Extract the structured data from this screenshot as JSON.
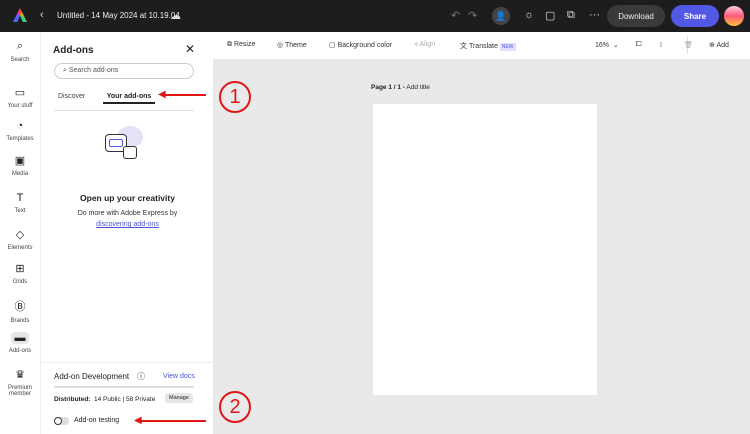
{
  "topbar": {
    "title": "Untitled - 14 May 2024 at 10.19.04",
    "download": "Download",
    "share": "Share"
  },
  "rail": [
    {
      "label": "Search",
      "icon": "⌕"
    },
    {
      "label": "Your stuff",
      "icon": "▭"
    },
    {
      "label": "Templates",
      "icon": "◔"
    },
    {
      "label": "Media",
      "icon": "▣"
    },
    {
      "label": "Text",
      "icon": "T"
    },
    {
      "label": "Elements",
      "icon": "◇"
    },
    {
      "label": "Grids",
      "icon": "⊞"
    },
    {
      "label": "Brands",
      "icon": "Ⓑ"
    },
    {
      "label": "Add-ons",
      "icon": "▬"
    },
    {
      "label": "Premium member",
      "icon": "♛"
    }
  ],
  "panel": {
    "title": "Add-ons",
    "search_placeholder": "Search add-ons",
    "tabs": [
      "Discover",
      "Your add-ons"
    ],
    "empty_title": "Open up your creativity",
    "empty_text": "Do more with Adobe Express by",
    "empty_link": "discovering add-ons",
    "dev_title": "Add-on Development",
    "view_docs": "View docs",
    "distributed_label": "Distributed:",
    "distributed_value": "14 Public | 58 Private",
    "manage": "Manage",
    "testing": "Add-on testing"
  },
  "toolbar": {
    "resize": "Resize",
    "theme": "Theme",
    "background": "Background color",
    "align": "Align",
    "translate": "Translate",
    "new_badge": "NEW",
    "zoom": "16%",
    "add": "Add"
  },
  "canvas": {
    "page_label": "Page 1 / 1 -",
    "add_title": "Add title"
  },
  "annotations": [
    "1",
    "2"
  ]
}
